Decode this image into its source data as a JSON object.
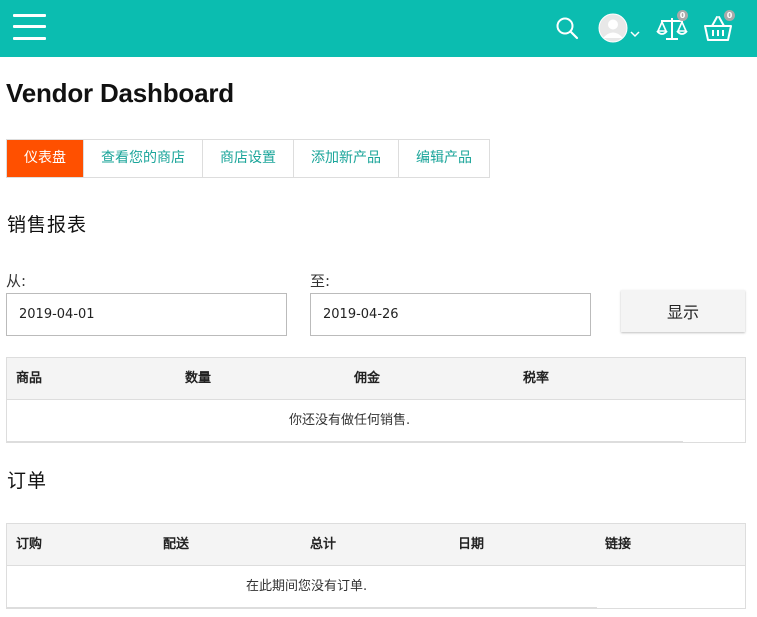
{
  "header": {
    "menu_icon": "hamburger-menu-icon",
    "search_icon": "search-icon",
    "avatar_icon": "user-avatar-icon",
    "dropdown_icon": "chevron-down-icon",
    "compare_icon": "scale-compare-icon",
    "compare_count": "0",
    "cart_icon": "basket-icon",
    "cart_count": "0",
    "bg_color": "#0bbdb0"
  },
  "page": {
    "title": "Vendor Dashboard"
  },
  "tabs": [
    {
      "label": "仪表盘",
      "active": true
    },
    {
      "label": "查看您的商店",
      "active": false
    },
    {
      "label": "商店设置",
      "active": false
    },
    {
      "label": "添加新产品",
      "active": false
    },
    {
      "label": "编辑产品",
      "active": false
    }
  ],
  "sales_report": {
    "heading": "销售报表",
    "from_label": "从:",
    "from_value": "2019-04-01",
    "to_label": "至:",
    "to_value": "2019-04-26",
    "show_button": "显示",
    "columns": [
      "商品",
      "数量",
      "佣金",
      "税率"
    ],
    "empty_message": "你还没有做任何销售."
  },
  "orders": {
    "heading": "订单",
    "columns": [
      "订购",
      "配送",
      "总计",
      "日期",
      "链接"
    ],
    "empty_message": "在此期间您没有订单."
  },
  "colors": {
    "accent": "#ff5000",
    "link": "#1ba59a",
    "header": "#0bbdb0"
  }
}
